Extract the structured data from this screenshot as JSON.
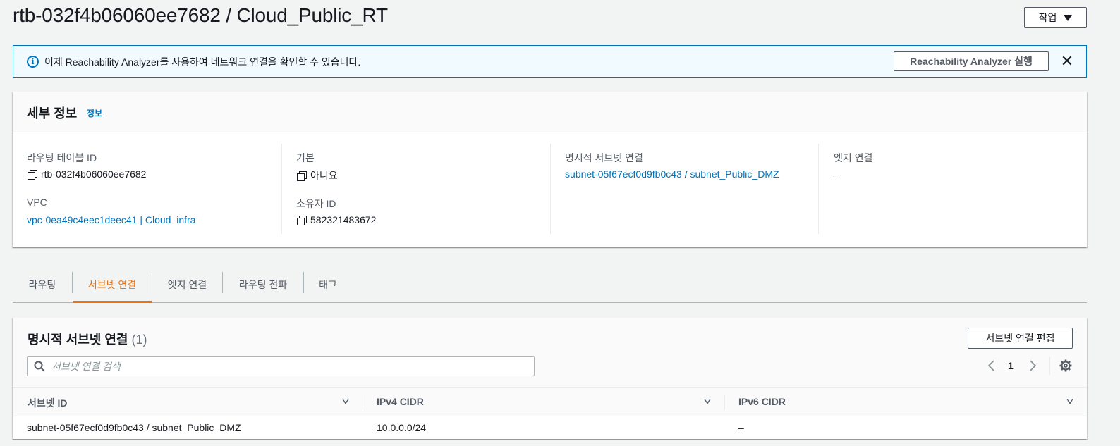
{
  "header": {
    "title": "rtb-032f4b06060ee7682 / Cloud_Public_RT",
    "actions_label": "작업"
  },
  "banner": {
    "text": "이제 Reachability Analyzer를 사용하여 네트워크 연결을 확인할 수 있습니다.",
    "button_label": "Reachability Analyzer 실행",
    "close_symbol": "✕",
    "info_symbol": "i"
  },
  "details": {
    "title": "세부 정보",
    "info_link": "정보",
    "fields": {
      "route_table_id": {
        "label": "라우팅 테이블 ID",
        "value": "rtb-032f4b06060ee7682"
      },
      "vpc": {
        "label": "VPC",
        "value": "vpc-0ea49c4eec1deec41 | Cloud_infra"
      },
      "main": {
        "label": "기본",
        "value": "아니요"
      },
      "owner_id": {
        "label": "소유자 ID",
        "value": "582321483672"
      },
      "explicit_subnet": {
        "label": "명시적 서브넷 연결",
        "value": "subnet-05f67ecf0d9fb0c43 / subnet_Public_DMZ"
      },
      "edge": {
        "label": "엣지 연결",
        "value": "–"
      }
    }
  },
  "tabs": [
    {
      "label": "라우팅",
      "active": false
    },
    {
      "label": "서브넷 연결",
      "active": true
    },
    {
      "label": "엣지 연결",
      "active": false
    },
    {
      "label": "라우팅 전파",
      "active": false
    },
    {
      "label": "태그",
      "active": false
    }
  ],
  "subnet_table": {
    "title": "명시적 서브넷 연결",
    "count": "(1)",
    "edit_button": "서브넷 연결 편집",
    "search_placeholder": "서브넷 연결 검색",
    "page": "1",
    "columns": [
      "서브넷 ID",
      "IPv4 CIDR",
      "IPv6 CIDR"
    ],
    "rows": [
      {
        "subnet_id": "subnet-05f67ecf0d9fb0c43 / subnet_Public_DMZ",
        "ipv4": "10.0.0.0/24",
        "ipv6": "–"
      }
    ]
  },
  "colors": {
    "link": "#0073bb",
    "active_tab": "#ec7211",
    "banner_bg": "#f1faff",
    "page_bg": "#f2f3f3"
  },
  "icons": [
    "info-icon",
    "close-icon",
    "copy-icon",
    "search-icon",
    "chevron-left-icon",
    "chevron-right-icon",
    "gear-icon",
    "sort-icon",
    "caret-down-icon"
  ]
}
